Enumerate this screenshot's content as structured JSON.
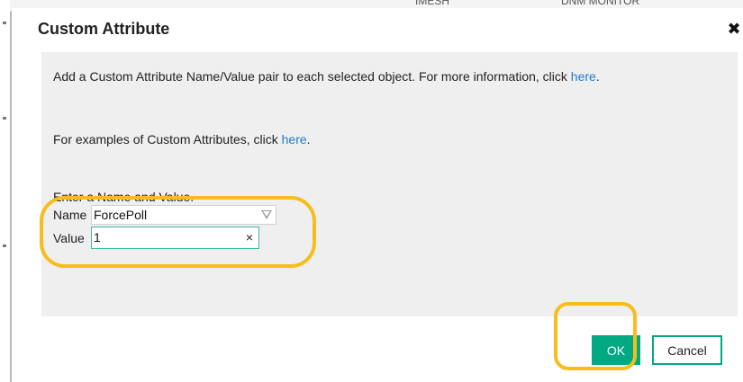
{
  "background": {
    "top_text_a": "IMESH",
    "top_text_b": "DNM MONITOR"
  },
  "dialog": {
    "title": "Custom Attribute",
    "close_icon": "close-icon",
    "line1_text": "Add a Custom Attribute Name/Value pair to each selected object. For more information, click ",
    "line1_link": "here",
    "line1_end": ".",
    "line2_text": "For examples of Custom Attributes, click ",
    "line2_link": "here",
    "line2_end": ".",
    "instruction": "Enter a Name and Value.",
    "name_label": "Name",
    "name_value": "ForcePoll",
    "value_label": "Value",
    "value_value": "1",
    "clear_glyph": "×",
    "ok_label": "OK",
    "cancel_label": "Cancel"
  },
  "colors": {
    "accent": "#01a982",
    "link": "#1f7bc9",
    "highlight": "#f6bd1c",
    "panel": "#efefef"
  }
}
